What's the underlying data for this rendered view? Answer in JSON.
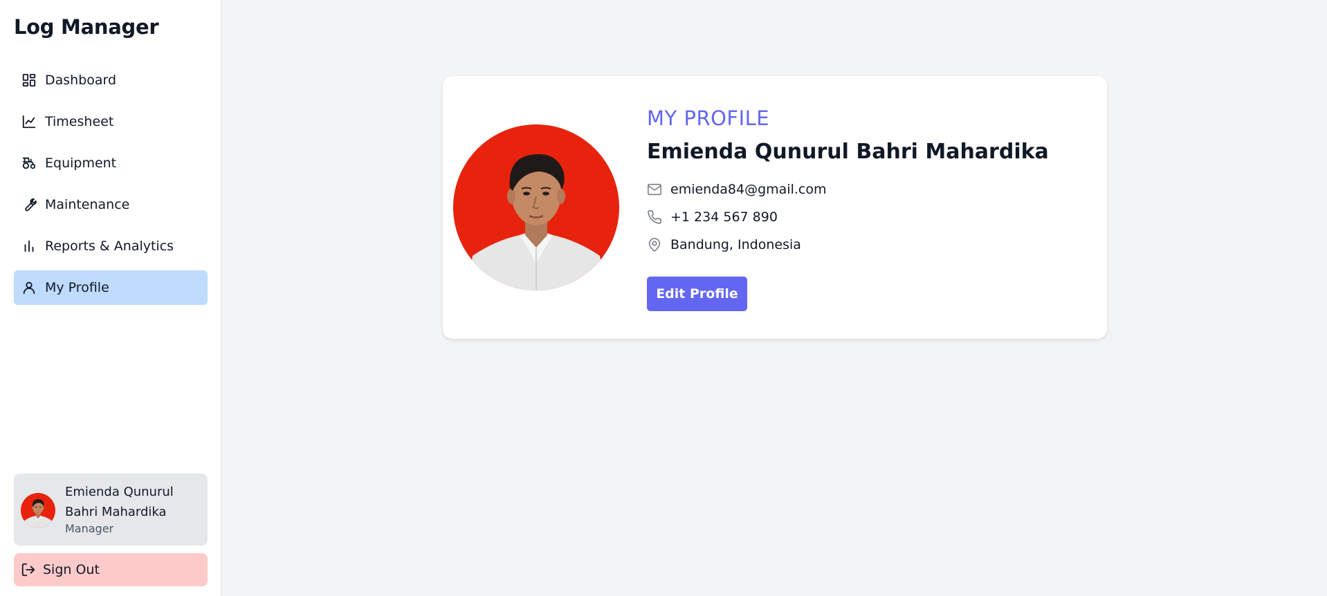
{
  "app": {
    "title": "Log Manager"
  },
  "sidebar": {
    "items": [
      {
        "label": "Dashboard",
        "icon": "dashboard-icon",
        "active": false
      },
      {
        "label": "Timesheet",
        "icon": "line-chart-icon",
        "active": false
      },
      {
        "label": "Equipment",
        "icon": "tractor-icon",
        "active": false
      },
      {
        "label": "Maintenance",
        "icon": "wrench-icon",
        "active": false
      },
      {
        "label": "Reports & Analytics",
        "icon": "bar-chart-icon",
        "active": false
      },
      {
        "label": "My Profile",
        "icon": "user-icon",
        "active": true
      }
    ],
    "user": {
      "name": "Emienda Qunurul Bahri Mahardika",
      "role": "Manager"
    },
    "sign_out_label": "Sign Out"
  },
  "profile": {
    "section_title": "MY PROFILE",
    "full_name": "Emienda Qunurul Bahri Mahardika",
    "email": "emienda84@gmail.com",
    "phone": "+1 234 567 890",
    "location": "Bandung, Indonesia",
    "edit_label": "Edit Profile"
  },
  "colors": {
    "accent": "#6366f1",
    "active_nav_bg": "#bfdbfe",
    "sign_out_bg": "#fecaca",
    "photo_background": "#e8230d"
  }
}
